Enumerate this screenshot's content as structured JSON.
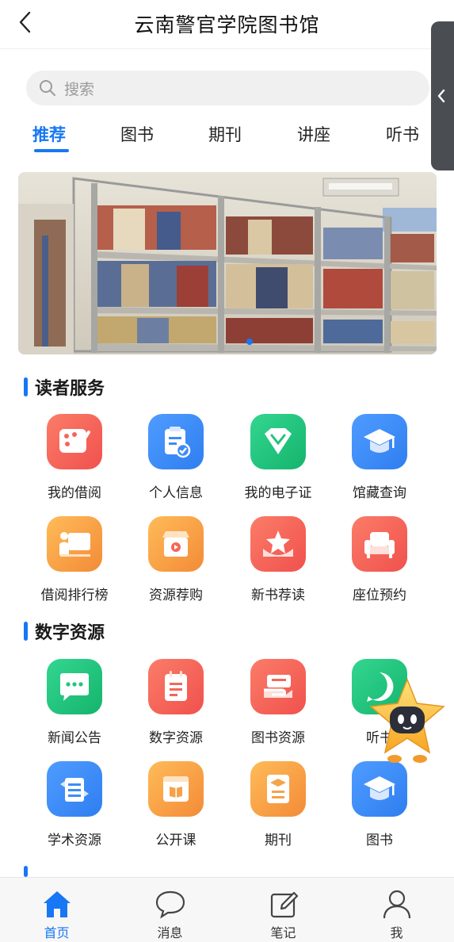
{
  "header": {
    "title": "云南警官学院图书馆",
    "back_icon": "chevron-left-icon"
  },
  "search": {
    "placeholder": "搜索",
    "icon": "search-icon"
  },
  "tabs": [
    {
      "label": "推荐",
      "active": true
    },
    {
      "label": "图书",
      "active": false
    },
    {
      "label": "期刊",
      "active": false
    },
    {
      "label": "讲座",
      "active": false
    },
    {
      "label": "听书",
      "active": false
    }
  ],
  "banner": {
    "icon": "library-bookshelf-photo",
    "slide_count": 1,
    "active_slide": 1
  },
  "sections": [
    {
      "title": "读者服务",
      "items": [
        {
          "label": "我的借阅",
          "icon": "palette-icon",
          "color": "#f5655a"
        },
        {
          "label": "个人信息",
          "icon": "clipboard-check-icon",
          "color": "#3b8cf6"
        },
        {
          "label": "我的电子证",
          "icon": "gem-icon",
          "color": "#22c47e"
        },
        {
          "label": "馆藏查询",
          "icon": "graduation-cap-icon",
          "color": "#3b8cf6"
        },
        {
          "label": "借阅排行榜",
          "icon": "podium-board-icon",
          "color": "#f6a24a"
        },
        {
          "label": "资源荐购",
          "icon": "shop-icon",
          "color": "#f6a24a"
        },
        {
          "label": "新书荐读",
          "icon": "star-badge-icon",
          "color": "#f5655a"
        },
        {
          "label": "座位预约",
          "icon": "armchair-icon",
          "color": "#f5655a"
        }
      ]
    },
    {
      "title": "数字资源",
      "items": [
        {
          "label": "新闻公告",
          "icon": "chat-bubble-icon",
          "color": "#22c47e"
        },
        {
          "label": "数字资源",
          "icon": "notepad-icon",
          "color": "#f5655a"
        },
        {
          "label": "图书资源",
          "icon": "book-hand-icon",
          "color": "#f5655a"
        },
        {
          "label": "听书",
          "icon": "audio-c-icon",
          "color": "#22c47e"
        },
        {
          "label": "学术资源",
          "icon": "exchange-doc-icon",
          "color": "#3b8cf6"
        },
        {
          "label": "公开课",
          "icon": "open-book-icon",
          "color": "#f6a24a"
        },
        {
          "label": "期刊",
          "icon": "journal-cap-icon",
          "color": "#f6a24a"
        },
        {
          "label": "图书",
          "icon": "graduation-cap-icon",
          "color": "#3b8cf6"
        }
      ]
    }
  ],
  "robot_assistant": {
    "icon": "star-robot-mascot-icon"
  },
  "bottom_nav": [
    {
      "label": "首页",
      "icon": "home-icon",
      "active": true
    },
    {
      "label": "消息",
      "icon": "chat-icon",
      "active": false
    },
    {
      "label": "笔记",
      "icon": "edit-note-icon",
      "active": false
    },
    {
      "label": "我",
      "icon": "user-icon",
      "active": false
    }
  ],
  "colors": {
    "accent": "#1777f5",
    "coral": "#f5655a",
    "green": "#22c47e",
    "blue": "#3b8cf6",
    "orange": "#f6a24a"
  }
}
